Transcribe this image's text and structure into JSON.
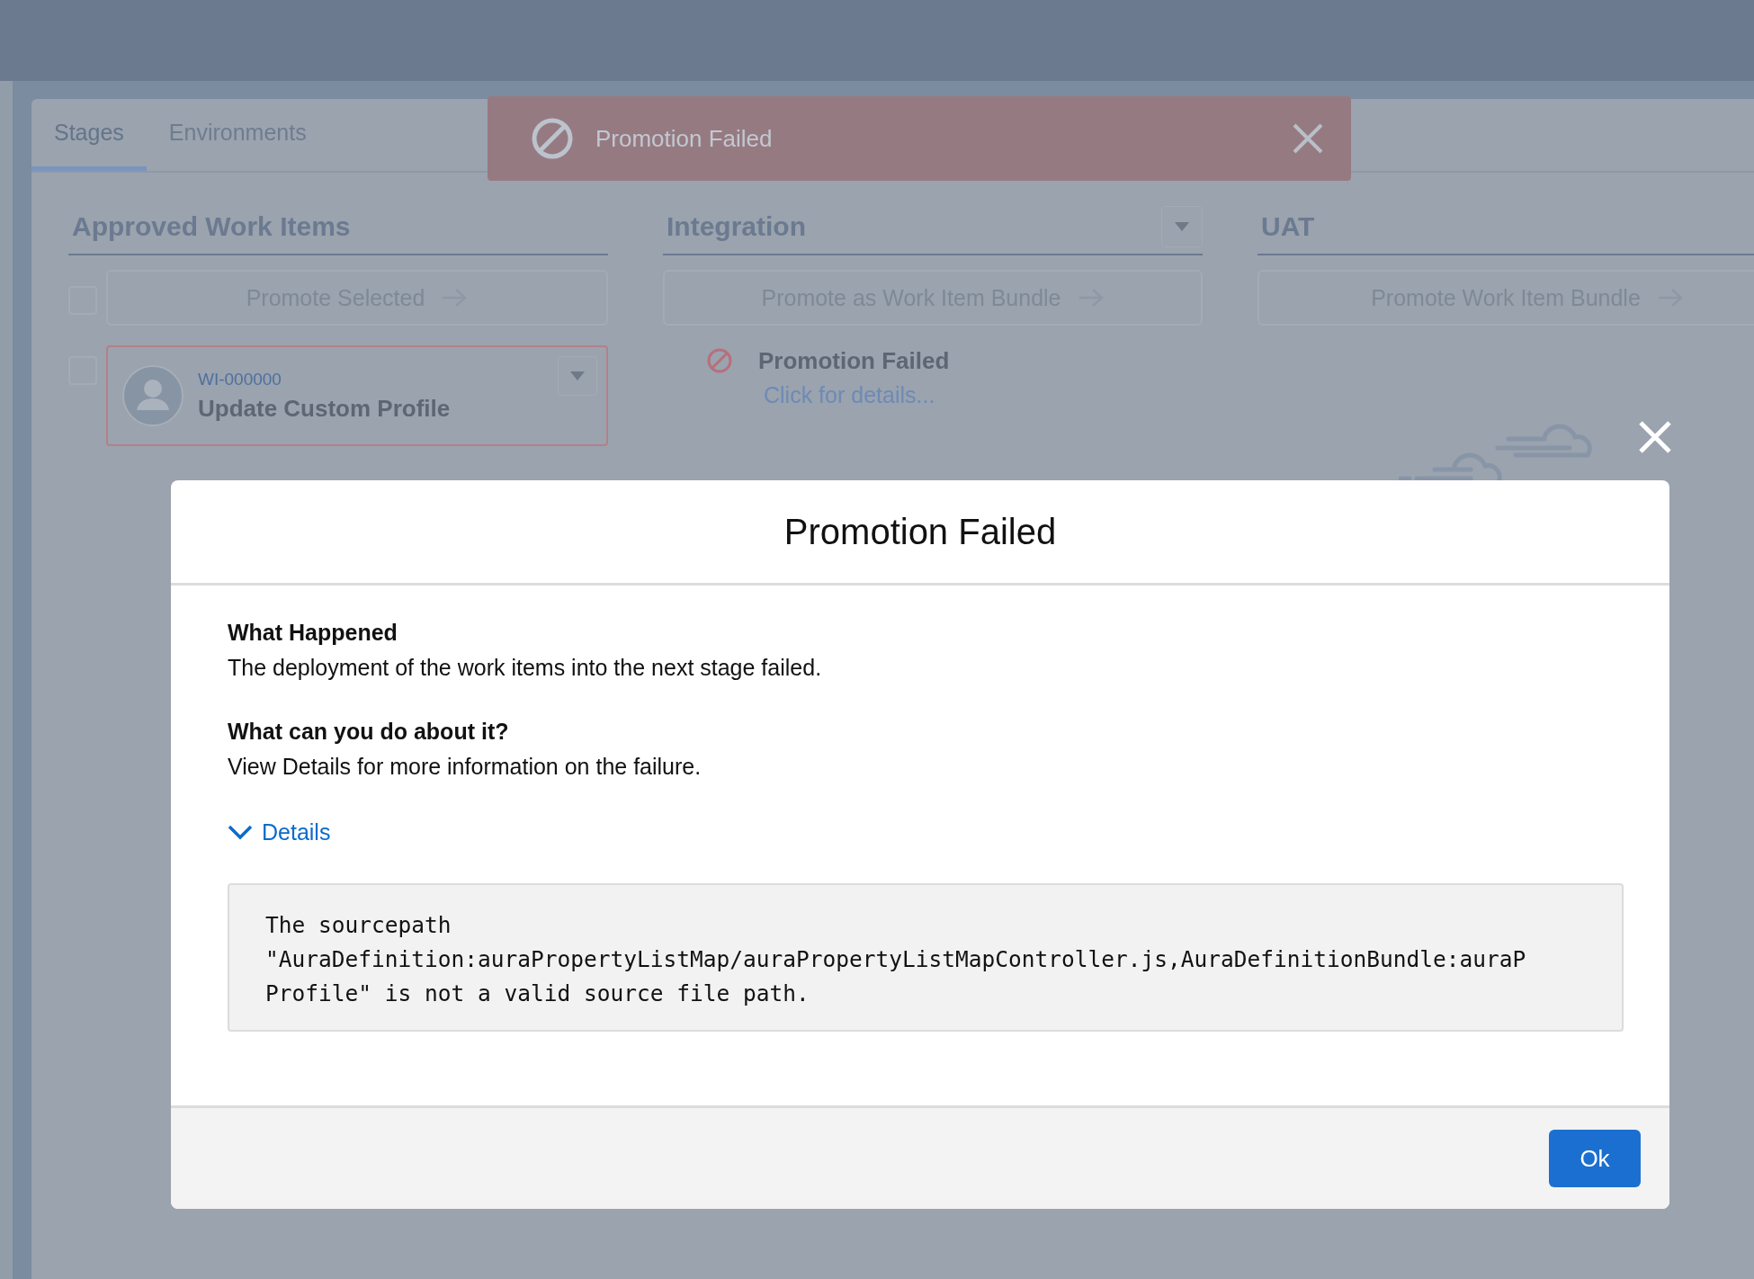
{
  "tabs": [
    {
      "label": "Stages",
      "selected": true
    },
    {
      "label": "Environments",
      "selected": false
    }
  ],
  "toast": {
    "title": "Promotion Failed"
  },
  "columns": [
    {
      "kind": "approved",
      "title": "Approved Work Items",
      "action": "Promote Selected",
      "select_all_checked": false,
      "items": [
        {
          "id": "WI-000000",
          "title": "Update Custom Profile",
          "checked": false
        }
      ]
    },
    {
      "kind": "stage",
      "title": "Integration",
      "dropdown": true,
      "action": "Promote as Work Item Bundle",
      "status": {
        "title": "Promotion Failed",
        "link": "Click for details..."
      }
    },
    {
      "kind": "stage",
      "title": "UAT",
      "dropdown": false,
      "action": "Promote Work Item Bundle"
    }
  ],
  "modal": {
    "title": "Promotion Failed",
    "sections": [
      {
        "heading": "What Happened",
        "text": "The deployment of the work items into the next stage failed."
      },
      {
        "heading": "What can you do about it?",
        "text": "View Details for more information on the failure."
      }
    ],
    "details": {
      "label": "Details",
      "expanded": true,
      "lines": [
        "The sourcepath",
        "\"AuraDefinition:auraPropertyListMap/auraPropertyListMapController.js,AuraDefinitionBundle:auraP",
        "Profile\" is not a valid source file path."
      ]
    },
    "button": "Ok"
  }
}
